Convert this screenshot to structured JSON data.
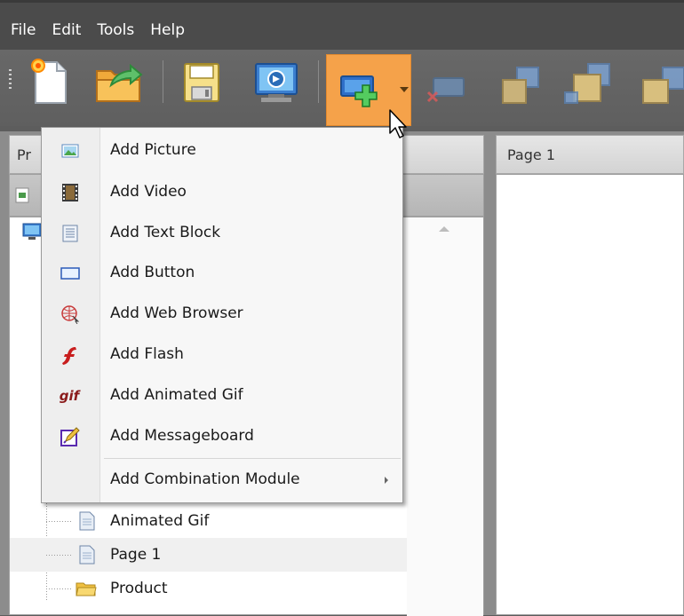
{
  "menubar": {
    "items": [
      "File",
      "Edit",
      "Tools",
      "Help"
    ]
  },
  "toolbar": {
    "buttons": [
      {
        "name": "new-icon"
      },
      {
        "name": "open-icon"
      },
      {
        "name": "save-icon"
      },
      {
        "name": "publish-icon"
      },
      {
        "name": "add-module-icon"
      },
      {
        "name": "delete-module-icon"
      },
      {
        "name": "bring-forward-icon"
      },
      {
        "name": "send-backward-icon"
      },
      {
        "name": "bring-to-front-icon"
      }
    ],
    "accent_color": "#f5a24a"
  },
  "left_panel": {
    "header_label": "Pr"
  },
  "tree": {
    "items": [
      {
        "label": "Animated Gif",
        "icon": "page-icon"
      },
      {
        "label": "Page 1",
        "icon": "page-icon"
      },
      {
        "label": "Product",
        "icon": "folder-icon"
      }
    ]
  },
  "right_panel": {
    "header_label": "Page 1"
  },
  "dropdown": {
    "items": [
      {
        "label": "Add Picture",
        "icon": "picture-icon"
      },
      {
        "label": "Add Video",
        "icon": "video-icon"
      },
      {
        "label": "Add Text Block",
        "icon": "text-block-icon"
      },
      {
        "label": "Add Button",
        "icon": "button-icon"
      },
      {
        "label": "Add Web Browser",
        "icon": "web-browser-icon"
      },
      {
        "label": "Add Flash",
        "icon": "flash-icon"
      },
      {
        "label": "Add Animated Gif",
        "icon": "gif-icon"
      },
      {
        "label": "Add Messageboard",
        "icon": "messageboard-icon"
      },
      {
        "label": "Add Combination Module",
        "icon": "",
        "has_submenu": true
      }
    ],
    "gif_text": "gif"
  }
}
